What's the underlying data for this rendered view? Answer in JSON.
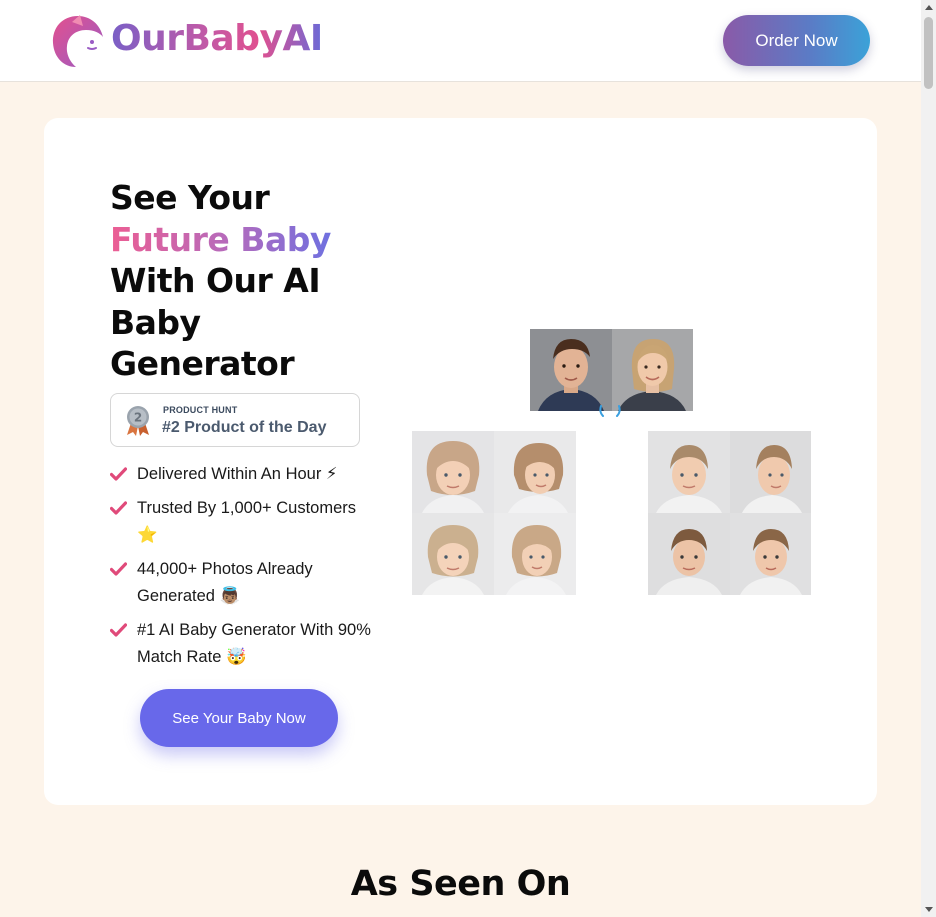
{
  "brand": {
    "name": "OurBabyAI"
  },
  "header": {
    "order_label": "Order Now"
  },
  "hero": {
    "line1": "See Your",
    "line2": "Future Baby",
    "line3": "With Our AI",
    "line4": "Baby",
    "line5": "Generator"
  },
  "badge": {
    "rank": "2",
    "kicker": "PRODUCT HUNT",
    "title": "#2 Product of the Day"
  },
  "features": [
    "Delivered Within An Hour ⚡",
    "Trusted By 1,000+ Customers ⭐",
    "44,000+ Photos Already Generated 👼🏽",
    "#1 AI Baby Generator With 90% Match Rate 🤯"
  ],
  "cta": {
    "label": "See Your Baby Now"
  },
  "section": {
    "title": "As Seen On"
  },
  "colors": {
    "cta": "#6868ea",
    "accent_pink": "#ec5e93",
    "check": "#e04a7a"
  },
  "icons": {
    "check": "check-icon",
    "medal": "medal-icon",
    "logo": "unicorn-logo-icon"
  }
}
